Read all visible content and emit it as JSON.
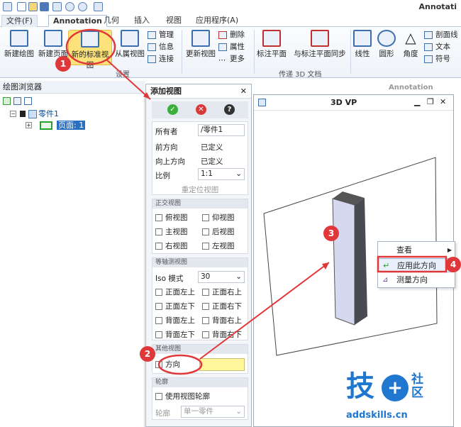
{
  "app": {
    "title": "Annotati"
  },
  "tabs": [
    {
      "label": "文件(F)"
    },
    {
      "label": "Annotation"
    },
    {
      "label": "几何"
    },
    {
      "label": "插入"
    },
    {
      "label": "视图"
    },
    {
      "label": "应用程序(A)"
    }
  ],
  "ribbon": {
    "new_drawing": "新建绘图",
    "new_page": "新建页面",
    "new_standard_view": "新的标准视图",
    "sub_view": "从属视图",
    "manage": "管理",
    "info": "信息",
    "connect": "连接",
    "update_view": "更新视图",
    "delete": "删除",
    "property": "属性",
    "more": "更多",
    "annotate_plane": "标注平面",
    "sync_plane": "与标注平面同步",
    "linear": "线性",
    "circular": "圆形",
    "angle": "角度",
    "section_line": "剖面线",
    "text": "文本",
    "symbol": "符号",
    "group_setup": "设置",
    "group_3d": "传递 3D 文档"
  },
  "browser": {
    "title": "绘图浏览器",
    "part": "零件1",
    "page": "页面: 1"
  },
  "addview": {
    "title": "添加视图",
    "owner_label": "所有者",
    "owner_value": "/零件1",
    "front_label": "前方向",
    "front_value": "已定义",
    "up_label": "向上方向",
    "up_value": "已定义",
    "scale_label": "比例",
    "scale_value": "1:1",
    "reposition": "重定位视图",
    "ortho_title": "正交视图",
    "ortho": [
      "俯视图",
      "仰视图",
      "主视图",
      "后视图",
      "右视图",
      "左视图"
    ],
    "iso_title": "等轴测视图",
    "iso_mode_label": "Iso 模式",
    "iso_mode_value": "30",
    "iso": [
      "正面左上",
      "正面右上",
      "正面左下",
      "正面右下",
      "背面左上",
      "背面右上",
      "背面左下",
      "背面右下"
    ],
    "custom_title": "其他视图",
    "direction": "方向",
    "outline_title": "轮廓",
    "use_outline": "使用视图轮廓",
    "outline_label": "轮廓",
    "outline_value": "单一零件"
  },
  "viewport": {
    "title": "3D VP",
    "annotation_ghost": "Annotation"
  },
  "context_menu": [
    "查看",
    "应用此方向",
    "测量方向"
  ],
  "callouts": [
    "1",
    "2",
    "3",
    "4"
  ],
  "watermark": {
    "brand_1": "技",
    "brand_2": "社区",
    "url": "addskills.cn"
  },
  "colors": {
    "accent": "#e0383a",
    "highlight": "#fff59a"
  }
}
